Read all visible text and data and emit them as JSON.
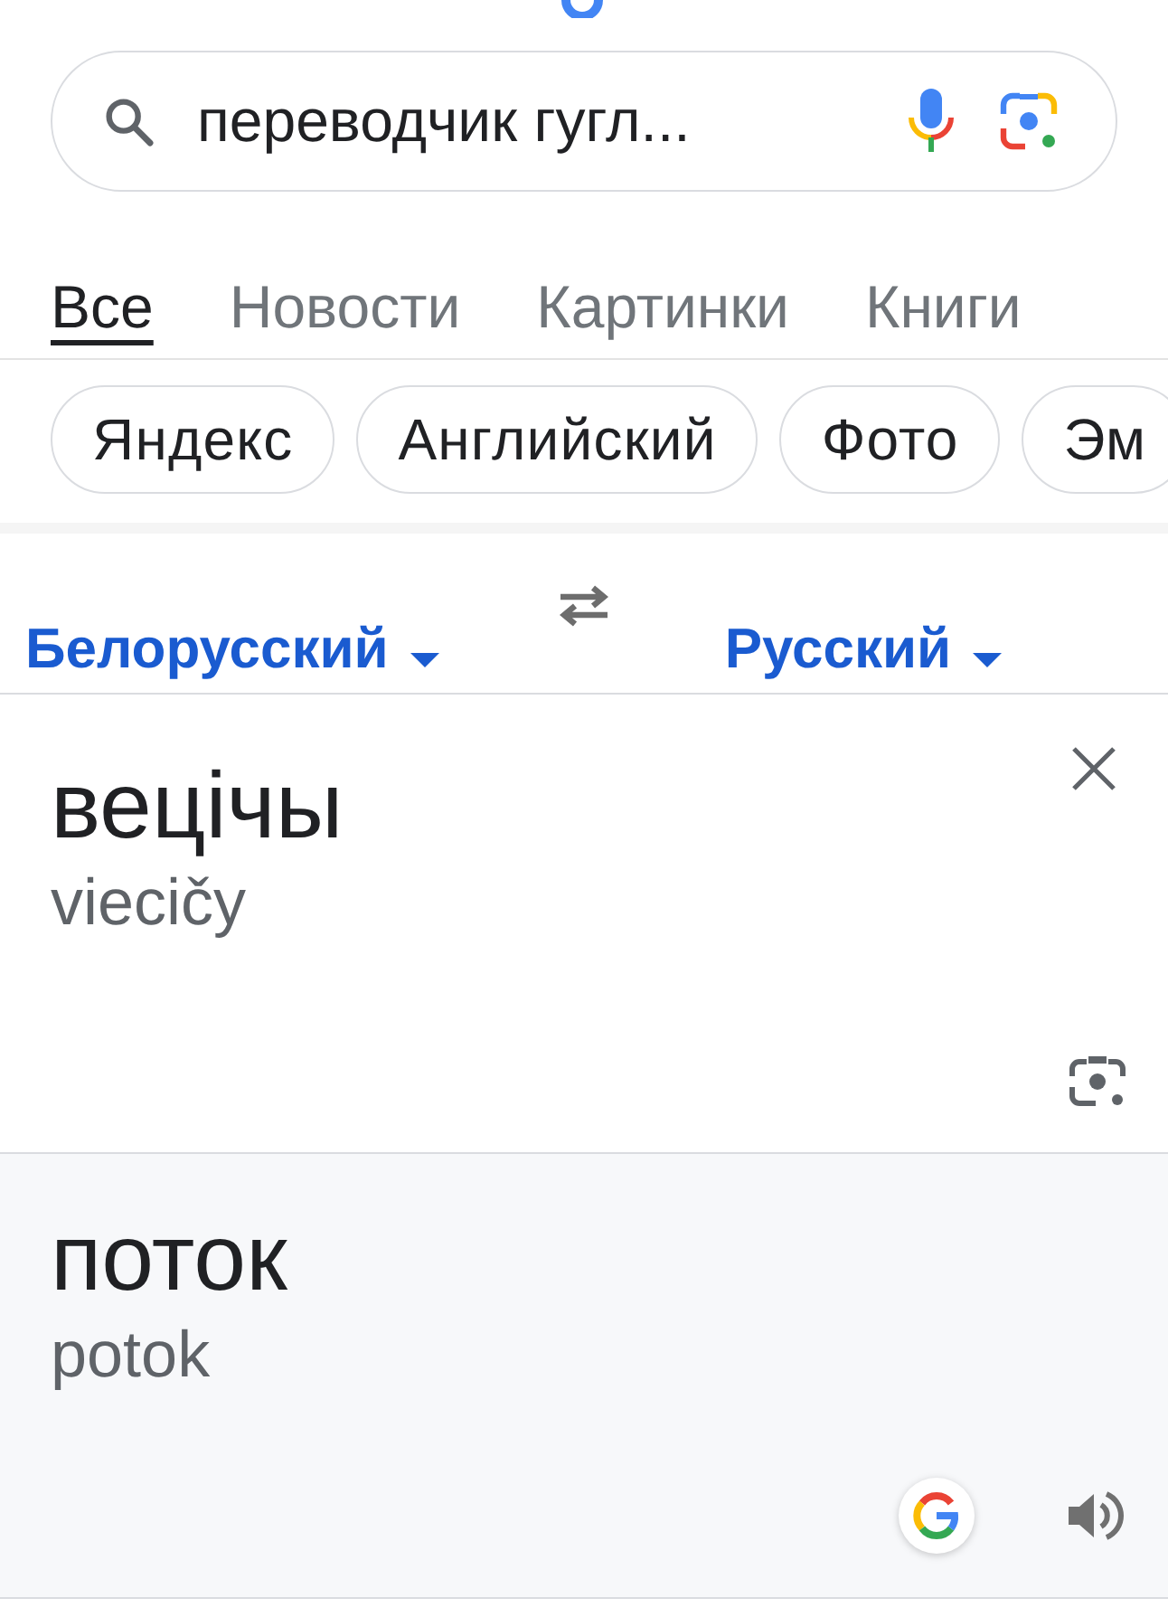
{
  "search": {
    "value": "переводчик гугл..."
  },
  "tabs": [
    {
      "label": "Все",
      "selected": true
    },
    {
      "label": "Новости",
      "selected": false
    },
    {
      "label": "Картинки",
      "selected": false
    },
    {
      "label": "Книги",
      "selected": false
    }
  ],
  "chips": [
    "Яндекс",
    "Английский",
    "Фото",
    "Эм"
  ],
  "translator": {
    "source_language": "Белорусский",
    "target_language": "Русский",
    "source": {
      "text": "вецічы",
      "transliteration": "viecičy"
    },
    "target": {
      "text": "поток",
      "transliteration": "potok"
    }
  }
}
